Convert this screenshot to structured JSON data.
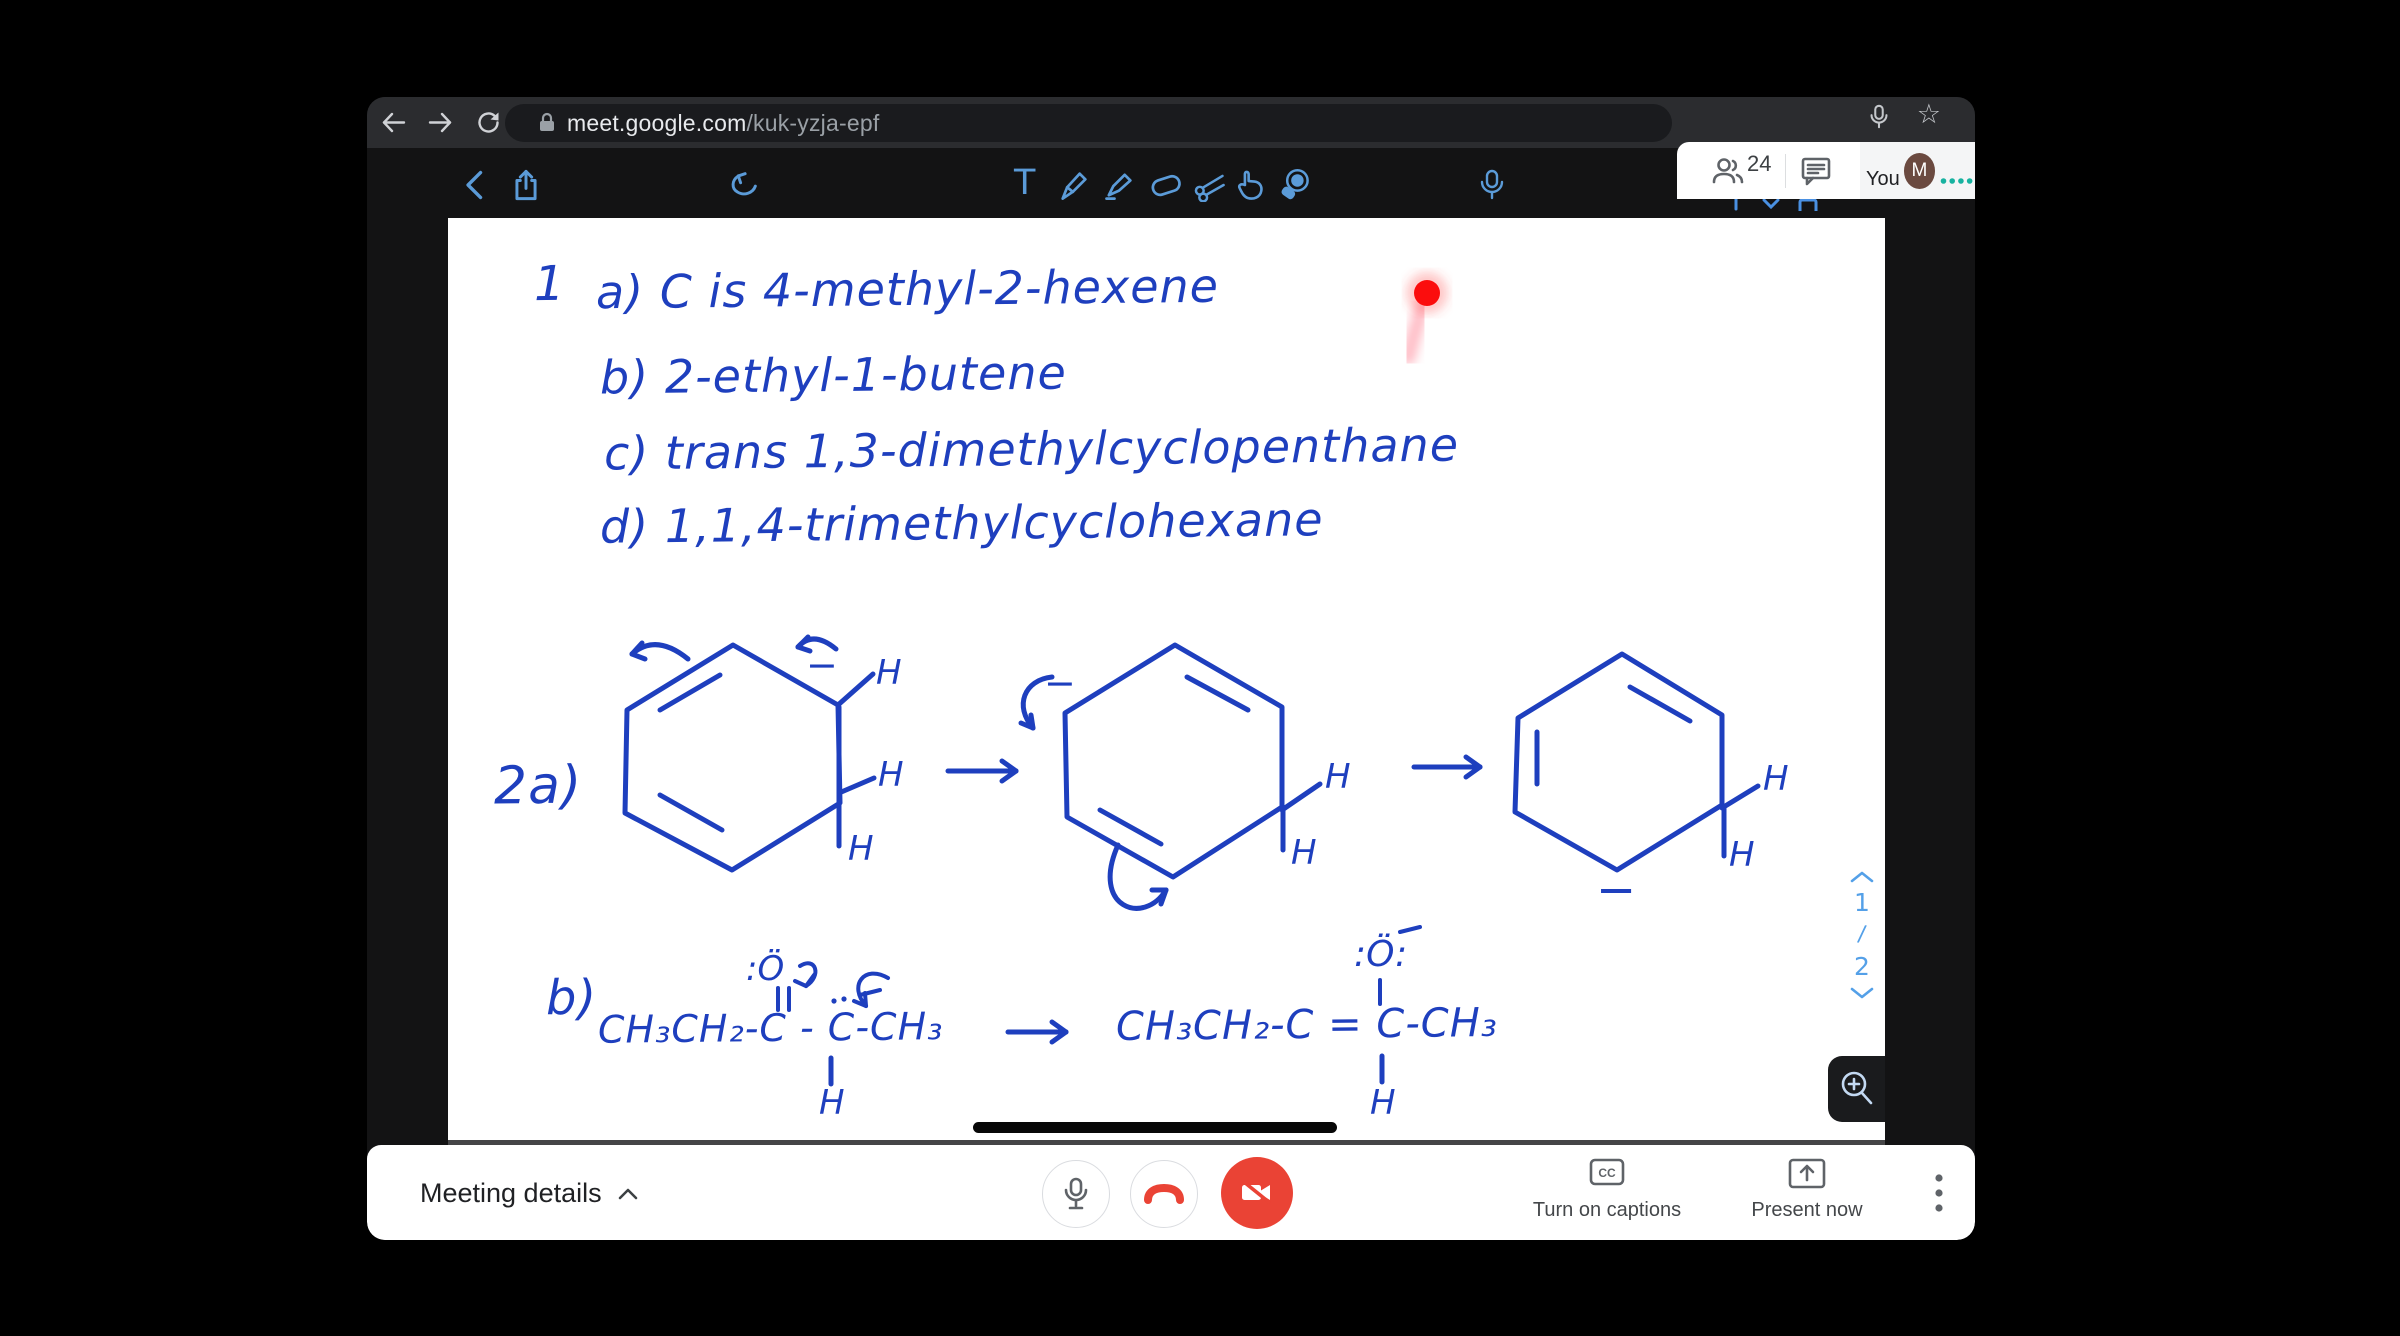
{
  "browser": {
    "url_domain": "meet.google.com",
    "url_path": "/kuk-yzja-epf"
  },
  "meet_panel": {
    "participant_count": "24",
    "you_label": "You",
    "avatar_initial": "M"
  },
  "wb_toolbar": {
    "text_tool": "T"
  },
  "notes": {
    "line1_num": "1",
    "line1": "a) C is 4-methyl-2-hexene",
    "line2": "b) 2-ethyl-1-butene",
    "line3": "c) trans 1,3-dimethylcyclopenthane",
    "line4": "d) 1,1,4-trimethylcyclohexane",
    "section2_label": "2a)",
    "sectionb_label": "b)"
  },
  "chem": {
    "h": "H",
    "minus": "−",
    "o_left": ":Ö",
    "o_right": ":Ö:",
    "formula_left": "CH₃CH₂-C - C-CH₃",
    "formula_right": "CH₃CH₂-C = C-CH₃"
  },
  "pager": {
    "current": "1",
    "sep": "/",
    "total": "2"
  },
  "bottom_bar": {
    "meeting_details": "Meeting details",
    "captions_icon": "CC",
    "captions_label": "Turn on captions",
    "present_label": "Present now"
  },
  "colors": {
    "ink_blue": "#1e3fbe",
    "tool_blue": "#5b9bd8",
    "pager_blue": "#54a0e8",
    "meet_red": "#ea4335",
    "laser_red": "#fb0d0d",
    "teal_dots": "#17b2a0",
    "avatar_brown": "#6b4a40"
  }
}
